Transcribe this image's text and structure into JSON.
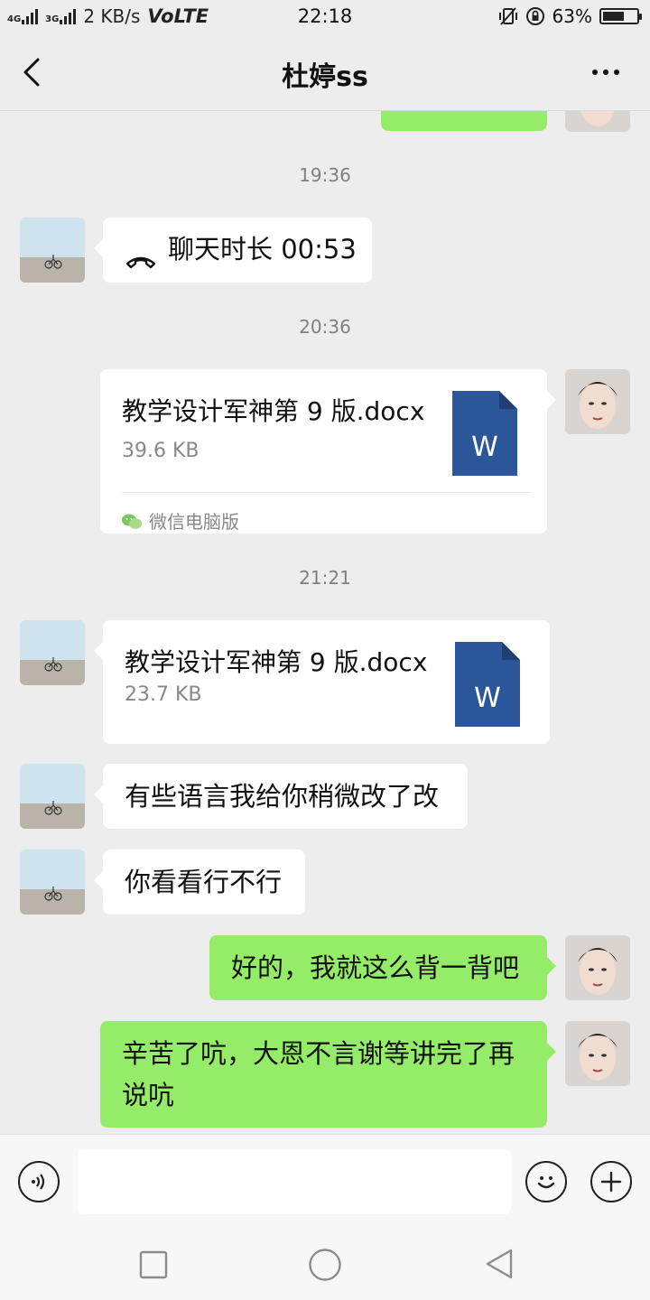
{
  "status_bar": {
    "network_1": "4G",
    "network_2": "3G",
    "speed": "2 KB/s",
    "volte": "VoLTE",
    "time": "22:18",
    "battery_percent": "63%",
    "battery_level": 0.63
  },
  "header": {
    "title": "杜婷ss",
    "back_icon": "chevron-left-icon",
    "more_icon": "ellipsis-icon"
  },
  "messages": {
    "time_1": "19:36",
    "call": {
      "text": "聊天时长 00:53",
      "icon": "phone-hangup-icon"
    },
    "time_2": "20:36",
    "file_1": {
      "name": "教学设计军神第 9 版.docx",
      "size": "39.6 KB",
      "source": "微信电脑版",
      "icon": "word-document-icon"
    },
    "time_3": "21:21",
    "file_2": {
      "name": "教学设计军神第 9 版.docx",
      "size": "23.7 KB",
      "icon": "word-document-icon"
    },
    "text_1": "有些语言我给你稍微改了改",
    "text_2": "你看看行不行",
    "text_3": "好的，我就这么背一背吧",
    "text_4": "辛苦了吭，大恩不言谢等讲完了再说吭"
  },
  "input_bar": {
    "voice_icon": "voice-icon",
    "emoji_icon": "emoji-icon",
    "add_icon": "plus-icon",
    "input_value": ""
  },
  "nav_bar": {
    "recent_icon": "square-icon",
    "home_icon": "circle-icon",
    "back_icon": "triangle-back-icon"
  },
  "colors": {
    "background": "#ededed",
    "bubble_out": "#95ec69",
    "bubble_in": "#ffffff",
    "word_blue": "#2b579a"
  }
}
